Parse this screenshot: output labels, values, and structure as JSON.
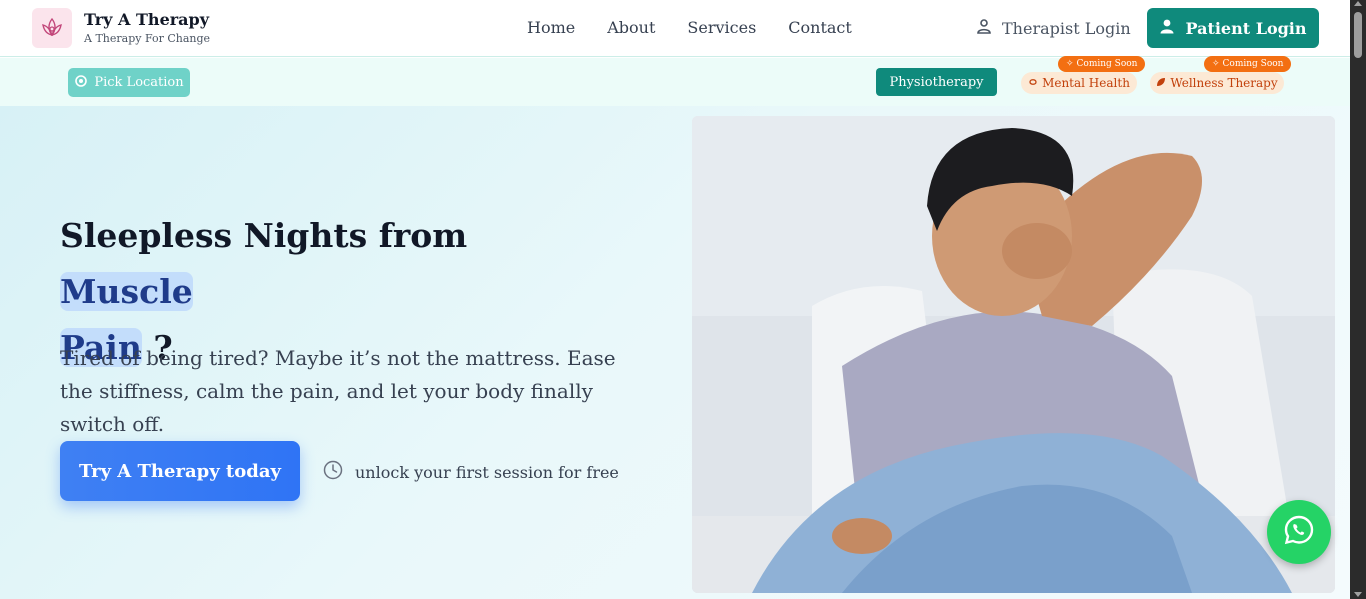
{
  "header": {
    "brand_title": "Try A Therapy",
    "brand_subtitle": "A Therapy For Change",
    "logo_icon": "lotus-icon",
    "nav": [
      {
        "label": "Home"
      },
      {
        "label": "About"
      },
      {
        "label": "Services"
      },
      {
        "label": "Contact"
      }
    ],
    "therapist_login": "Therapist Login",
    "patient_login": "Patient Login"
  },
  "subbar": {
    "pick_location": "Pick Location",
    "services": [
      {
        "label": "Physiotherapy",
        "active": true
      },
      {
        "label": "Mental Health",
        "badge": "Coming Soon",
        "icon": "brain-icon"
      },
      {
        "label": "Wellness Therapy",
        "badge": "Coming Soon",
        "icon": "leaf-icon"
      }
    ]
  },
  "hero": {
    "title_part1": "Sleepless Nights from",
    "title_highlight1": "Muscle",
    "title_highlight2": "Pain",
    "title_end": "?",
    "description": "Tired of being tired? Maybe it’s not the mattress. Ease the stiffness, calm the pain, and let your body finally switch off.",
    "cta_label": "Try A Therapy today",
    "session_note": "unlock your first session for free"
  },
  "colors": {
    "primary_teal": "#0f8a7c",
    "cta_blue": "#2f74f5",
    "highlight_bg": "#c3ddfb",
    "coming_soon": "#f36f12",
    "whatsapp": "#25d366"
  }
}
